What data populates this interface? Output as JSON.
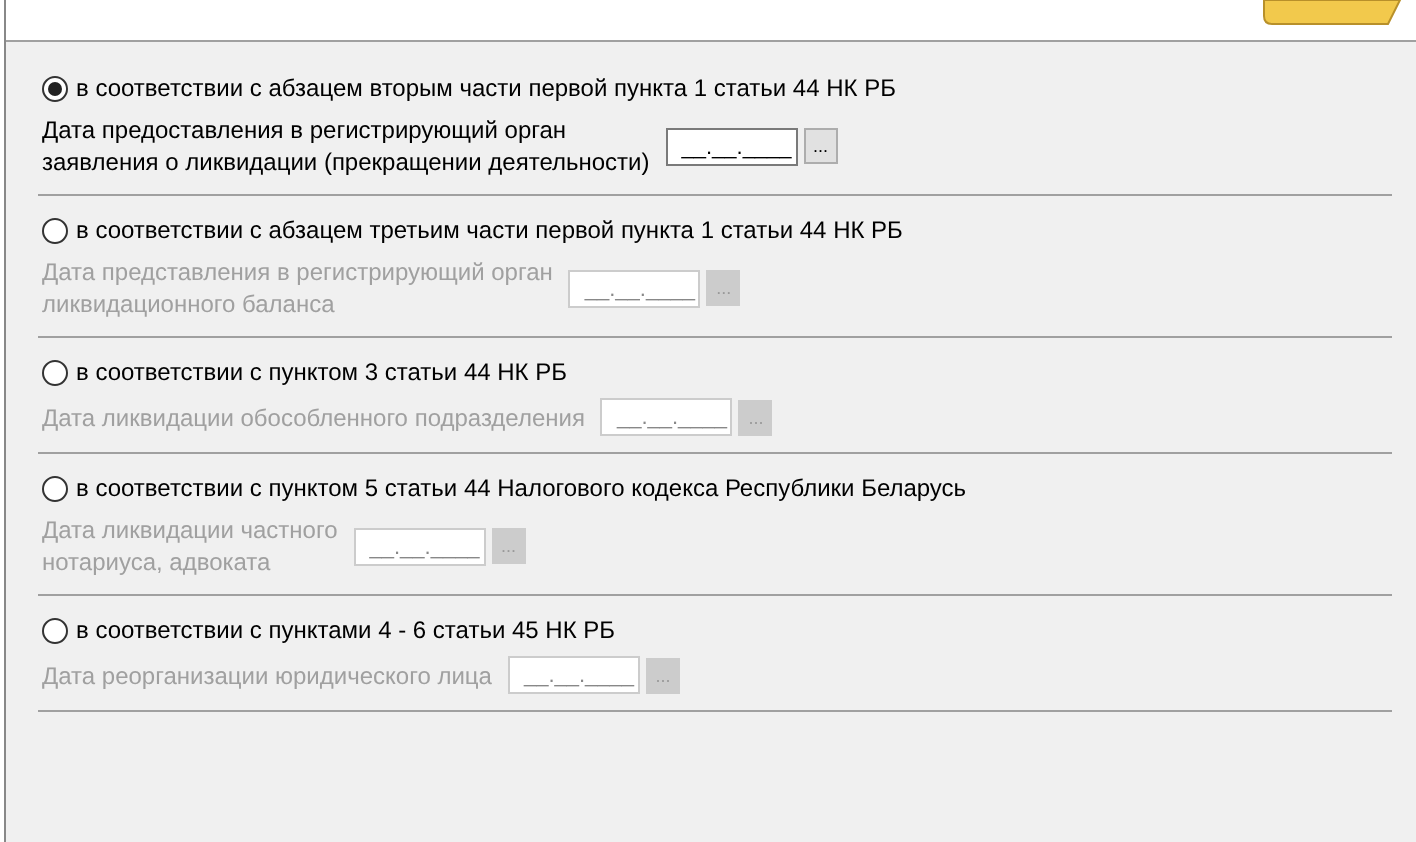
{
  "options": [
    {
      "label": "в соответствии с абзацем вторым части первой пункта 1 статьи 44 НК РБ",
      "selected": true,
      "date_label": [
        "Дата предоставления в регистрирующий орган",
        "заявления о ликвидации (прекращении деятельности)"
      ],
      "date_value": "__.__.____",
      "button": "..."
    },
    {
      "label": "в соответствии с абзацем третьим части первой пункта 1 статьи 44 НК РБ",
      "selected": false,
      "date_label": [
        "Дата представления в регистрирующий орган",
        "ликвидационного баланса"
      ],
      "date_value": "__.__.____",
      "button": "..."
    },
    {
      "label": "в соответствии с пунктом 3 статьи 44 НК РБ",
      "selected": false,
      "date_label": [
        "Дата ликвидации обособленного подразделения"
      ],
      "date_value": "__.__.____",
      "button": "..."
    },
    {
      "label": "в соответствии с пунктом 5 статьи 44 Налогового кодекса Республики Беларусь",
      "selected": false,
      "date_label": [
        "Дата ликвидации частного",
        "нотариуса, адвоката"
      ],
      "date_value": "__.__.____",
      "button": "..."
    },
    {
      "label": "в соответствии с пунктами 4 - 6 статьи 45 НК РБ",
      "selected": false,
      "date_label": [
        "Дата реорганизации юридического лица"
      ],
      "date_value": "__.__.____",
      "button": "..."
    }
  ]
}
